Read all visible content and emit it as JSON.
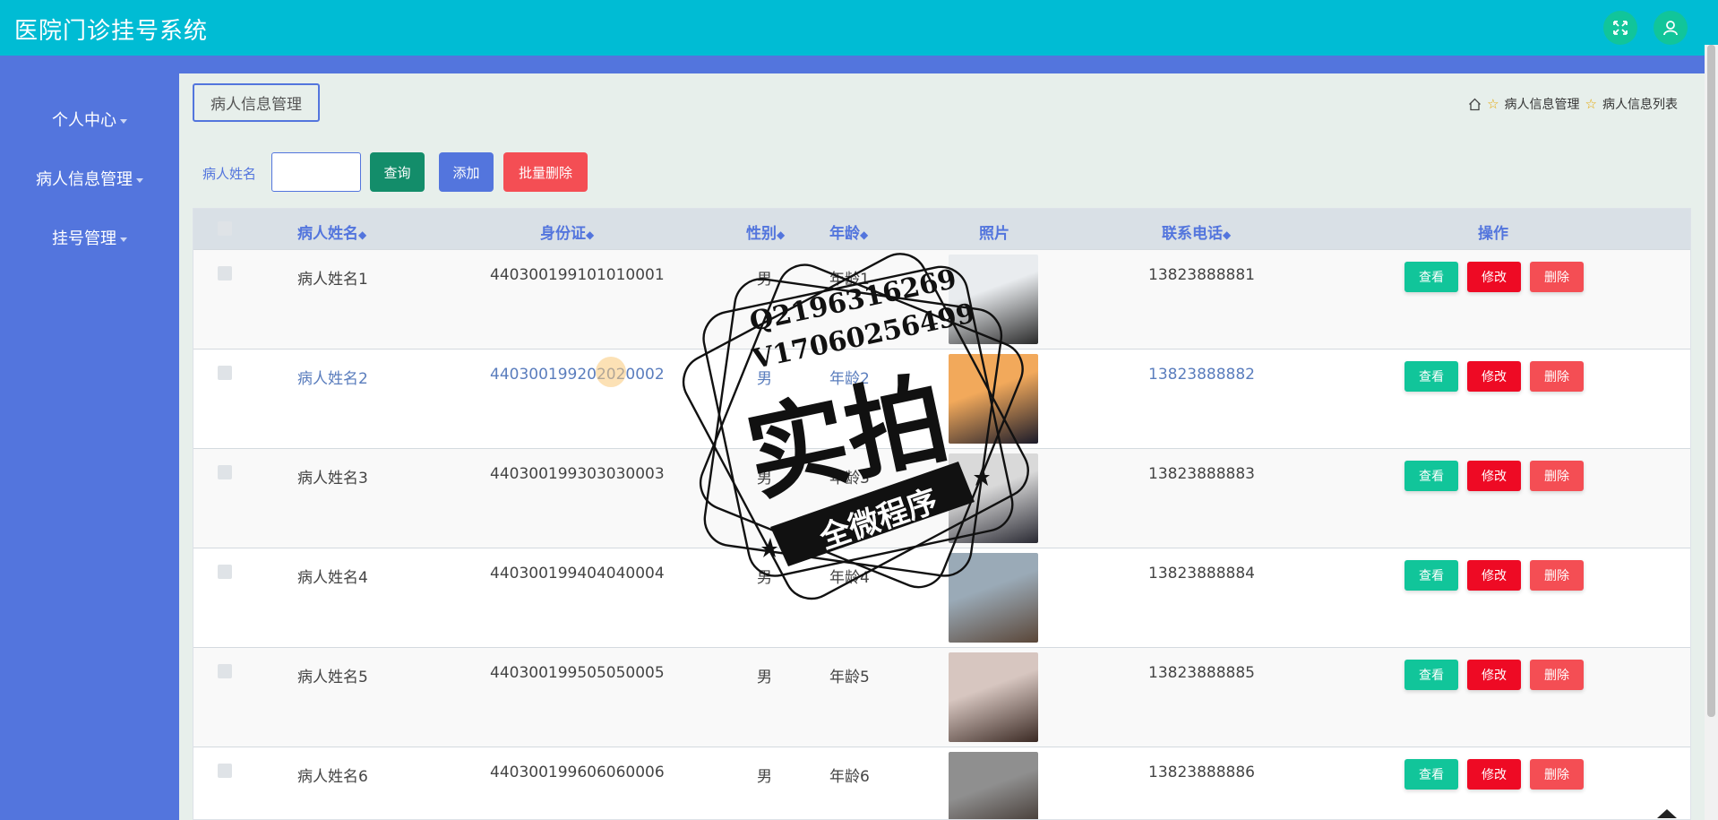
{
  "header": {
    "title": "医院门诊挂号系统"
  },
  "sidebar": {
    "items": [
      {
        "label": "个人中心"
      },
      {
        "label": "病人信息管理"
      },
      {
        "label": "挂号管理"
      }
    ]
  },
  "page": {
    "tab_label": "病人信息管理",
    "breadcrumb": [
      "病人信息管理",
      "病人信息列表"
    ]
  },
  "search": {
    "label": "病人姓名",
    "value": "",
    "query_btn": "查询",
    "add_btn": "添加",
    "batch_delete_btn": "批量删除"
  },
  "table": {
    "headers": [
      "病人姓名",
      "身份证",
      "性别",
      "年龄",
      "照片",
      "联系电话",
      "操作"
    ],
    "action_labels": {
      "view": "查看",
      "edit": "修改",
      "delete": "删除"
    },
    "rows": [
      {
        "name": "病人姓名1",
        "id_card": "440300199101010001",
        "gender": "男",
        "age": "年龄1",
        "phone": "13823888881"
      },
      {
        "name": "病人姓名2",
        "id_card": "440300199202020002",
        "gender": "男",
        "age": "年龄2",
        "phone": "13823888882"
      },
      {
        "name": "病人姓名3",
        "id_card": "440300199303030003",
        "gender": "男",
        "age": "年龄3",
        "phone": "13823888883"
      },
      {
        "name": "病人姓名4",
        "id_card": "440300199404040004",
        "gender": "男",
        "age": "年龄4",
        "phone": "13823888884"
      },
      {
        "name": "病人姓名5",
        "id_card": "440300199505050005",
        "gender": "男",
        "age": "年龄5",
        "phone": "13823888885"
      },
      {
        "name": "病人姓名6",
        "id_card": "440300199606060006",
        "gender": "男",
        "age": "年龄6",
        "phone": "13823888886"
      }
    ]
  },
  "watermark": {
    "line1": "Q2196316269",
    "line2": "V17060256499",
    "main": "实拍",
    "ribbon": "全微程序"
  },
  "colors": {
    "header_bg": "#00bcd4",
    "sidebar_bg": "#5375dd",
    "query": "#138d6a",
    "add": "#5375dd",
    "batch_delete": "#f44e54",
    "view": "#11c59a",
    "edit": "#ee0a24",
    "delete": "#f44e54"
  },
  "icons": [
    "fullscreen-icon",
    "user-icon",
    "home-icon",
    "star-icon",
    "sort-icon",
    "back-to-top-icon"
  ]
}
